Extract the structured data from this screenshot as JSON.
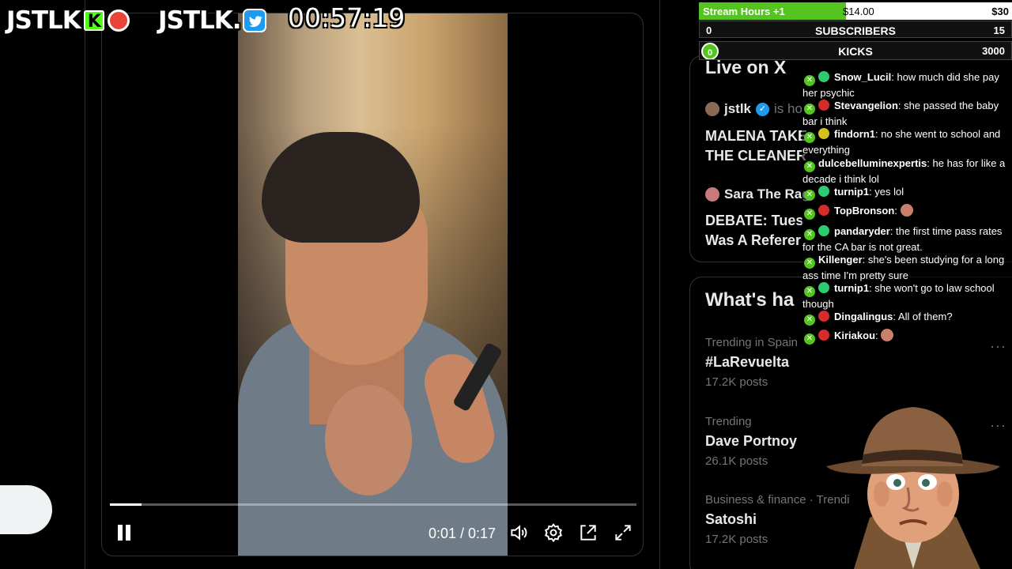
{
  "overlay": {
    "logo_kick": "JSTLK",
    "logo_kick_badge": "K",
    "logo_x": "JSTLK",
    "timer": "00:57:19"
  },
  "video": {
    "time": "0:01 / 0:17",
    "progress": 0.06
  },
  "goals": {
    "stream_hours_label": "Stream Hours +1",
    "stream_hours_current": "$14.00",
    "stream_hours_target": "$30",
    "stream_hours_progress": 0.47,
    "subscribers_left": "0",
    "subscribers_label": "SUBSCRIBERS",
    "subscribers_right": "15",
    "kicks_left": "0",
    "kicks_label": "KICKS",
    "kicks_right": "3000"
  },
  "sidebar": {
    "live_title": "Live on X",
    "space1_host": "jstlk",
    "space1_suffix": "is ho",
    "space1_title": "MALENA TAKE\nTHE CLEANER",
    "space2_host": "Sara The Rag",
    "space2_title": "DEBATE: Tues\nWas A Referer",
    "trends_heading": "What's ha",
    "trends": [
      {
        "context": "Trending in Spain",
        "name": "#LaRevuelta",
        "count": "17.2K posts"
      },
      {
        "context": "Trending",
        "name": "Dave Portnoy",
        "count": "26.1K posts"
      },
      {
        "context": "Business & finance · Trendi",
        "name": "Satoshi",
        "count": "17.2K posts"
      }
    ],
    "more_label": "···"
  },
  "chat": [
    {
      "user": "Snow_Lucil",
      "text": "how much did she pay her psychic",
      "badge_color": "#2ecc71"
    },
    {
      "user": "Stevangelion",
      "text": "she passed the baby bar i think",
      "badge_color": "#d62b2b"
    },
    {
      "user": "findorn1",
      "text": "no she went to school and everything",
      "badge_color": "#d4c21c"
    },
    {
      "user": "dulcebelluminexpertis",
      "text": "he has for like a decade i think lol",
      "badge_color": ""
    },
    {
      "user": "turnip1",
      "text": "yes lol",
      "badge_color": "#2ecc71"
    },
    {
      "user": "TopBronson",
      "text": "",
      "badge_color": "#d62b2b"
    },
    {
      "user": "pandaryder",
      "text": "the first time pass rates for the CA bar is not great.",
      "badge_color": "#2ecc71"
    },
    {
      "user": "Killenger",
      "text": "she's been studying for a long ass time I'm pretty sure",
      "badge_color": ""
    },
    {
      "user": "turnip1",
      "text": "she won't go to law school though",
      "badge_color": "#2ecc71"
    },
    {
      "user": "Dingalingus",
      "text": "All of them?",
      "badge_color": "#d62b2b"
    },
    {
      "user": "Kiriakou",
      "text": "",
      "badge_color": "#d62b2b"
    }
  ],
  "colors": {
    "kick_green": "#53fc18",
    "x_blue": "#1d9bf0",
    "goal_green": "#53c51e",
    "border": "#2f3336"
  }
}
